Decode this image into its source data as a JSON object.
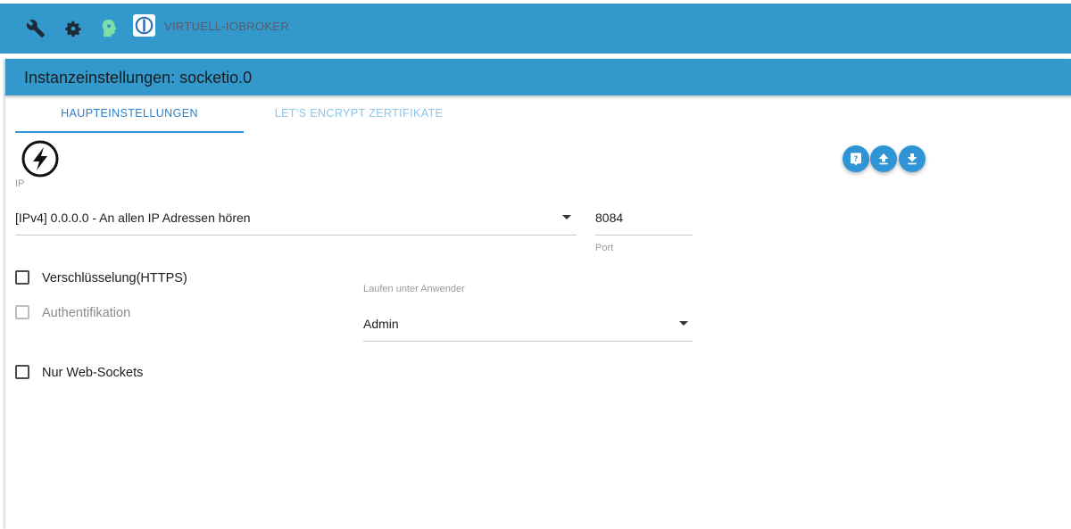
{
  "header": {
    "icons": [
      "wrench-icon",
      "settings-gear-icon",
      "brain-head-icon"
    ],
    "brand_text": "VIRTUELL-IOBROKER",
    "brand_logo": "iobroker-logo"
  },
  "page": {
    "title": "Instanzeinstellungen: socketio.0",
    "tabs": [
      {
        "label": "HAUPTEINSTELLUNGEN",
        "active": true
      },
      {
        "label": "LET'S ENCRYPT ZERTIFIKATE",
        "active": false
      }
    ],
    "action_buttons": [
      "help-icon",
      "upload-icon",
      "download-icon"
    ]
  },
  "form": {
    "ip_label": "IP",
    "ip_value": "[IPv4] 0.0.0.0 - An allen IP Adressen hören",
    "port_value": "8084",
    "port_label": "Port",
    "https_label": "Verschlüsselung(HTTPS)",
    "https_checked": false,
    "auth_label": "Authentifikation",
    "auth_checked": false,
    "auth_disabled": true,
    "run_as_label": "Laufen unter Anwender",
    "run_as_value": "Admin",
    "websockets_label": "Nur Web-Sockets",
    "websockets_checked": false
  },
  "colors": {
    "primary": "#3399cc",
    "accent_button": "#2f94d6",
    "tab_active": "#2a7fc8",
    "tab_inactive": "#8ec3ea",
    "brain_icon": "#7ee0a6"
  }
}
